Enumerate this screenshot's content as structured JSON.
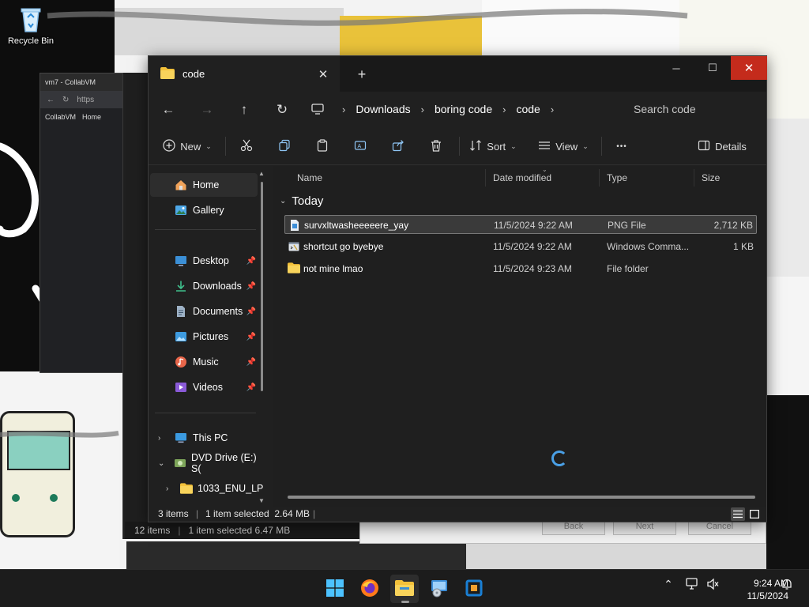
{
  "desktop": {
    "recycle_bin_label": "Recycle Bin",
    "bg_browser": {
      "tab_title": "vm7 - CollabVM",
      "address": "https",
      "site_label": "CollabVM",
      "home_link": "Home"
    },
    "bg_explorer_status": {
      "items": "12 items",
      "selected": "1 item selected  6.47 MB"
    },
    "bg_dialog": {
      "back": "Back",
      "next": "Next",
      "cancel": "Cancel"
    }
  },
  "window": {
    "tab_title": "code",
    "controls": {
      "minimize": "─",
      "maximize": "☐",
      "close": "✕"
    },
    "breadcrumb": [
      "Downloads",
      "boring code",
      "code"
    ],
    "search_placeholder": "Search code",
    "toolbar": {
      "new_label": "New",
      "sort_label": "Sort",
      "view_label": "View",
      "more_label": "•••",
      "details_label": "Details"
    },
    "nav": {
      "home": "Home",
      "gallery": "Gallery",
      "pinned": [
        {
          "label": "Desktop",
          "icon": "desktop-icon"
        },
        {
          "label": "Downloads",
          "icon": "downloads-icon"
        },
        {
          "label": "Documents",
          "icon": "documents-icon"
        },
        {
          "label": "Pictures",
          "icon": "pictures-icon"
        },
        {
          "label": "Music",
          "icon": "music-icon"
        },
        {
          "label": "Videos",
          "icon": "videos-icon"
        }
      ],
      "this_pc": "This PC",
      "dvd_drive": "DVD Drive (E:) S(",
      "folder_sub": "1033_ENU_LP"
    },
    "columns": {
      "name": "Name",
      "date": "Date modified",
      "type": "Type",
      "size": "Size"
    },
    "group_label": "Today",
    "files": [
      {
        "name": "survxltwasheeeeere_yay",
        "date": "11/5/2024 9:22 AM",
        "type": "PNG File",
        "size": "2,712 KB",
        "icon": "image-file-icon",
        "selected": true
      },
      {
        "name": "shortcut go byebye",
        "date": "11/5/2024 9:22 AM",
        "type": "Windows Comma...",
        "size": "1 KB",
        "icon": "command-file-icon",
        "selected": false
      },
      {
        "name": "not mine lmao",
        "date": "11/5/2024 9:23 AM",
        "type": "File folder",
        "size": "",
        "icon": "folder-icon",
        "selected": false
      }
    ],
    "status": {
      "items": "3 items",
      "selected": "1 item selected  2.64 MB"
    }
  },
  "taskbar": {
    "apps": [
      "start-icon",
      "firefox-icon",
      "file-explorer-icon",
      "installer-icon",
      "virtualbox-icon"
    ],
    "time": "9:24 AM",
    "date": "11/5/2024"
  },
  "colors": {
    "accent": "#4aa0e6",
    "close_red": "#c42b1c",
    "folder_yellow": "#f3c13a",
    "window_bg": "#202020"
  }
}
